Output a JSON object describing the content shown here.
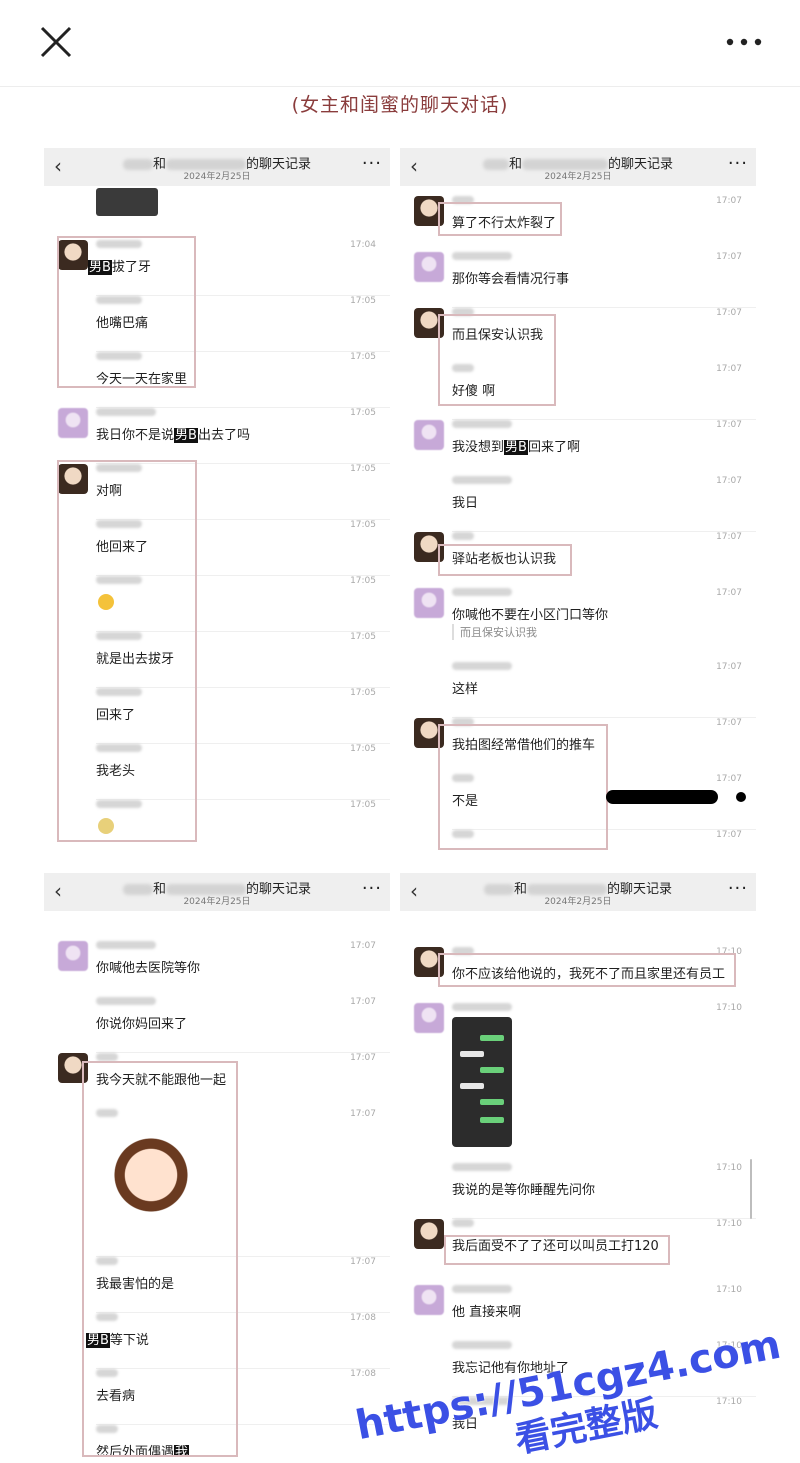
{
  "header": {
    "caption": "(女主和闺蜜的聊天对话)"
  },
  "panels": [
    {
      "title_and": "和",
      "title_suffix": "的聊天记录",
      "date": "2024年2月25日",
      "more": "···",
      "messages": [
        {
          "time": "17:04",
          "redact": "男B",
          "text": "拔了牙"
        },
        {
          "time": "17:05",
          "text": "他嘴巴痛"
        },
        {
          "time": "17:05",
          "text": "今天一天在家里"
        },
        {
          "time": "17:05",
          "prefix": "我日你不是说",
          "redact": "男B",
          "text": "出去了吗"
        },
        {
          "time": "17:05",
          "text": "对啊"
        },
        {
          "time": "17:05",
          "text": "他回来了"
        },
        {
          "time": "17:05",
          "text": ""
        },
        {
          "time": "17:05",
          "text": "就是出去拔牙"
        },
        {
          "time": "17:05",
          "text": "回来了"
        },
        {
          "time": "17:05",
          "text": "我老头"
        },
        {
          "time": "17:05",
          "text": ""
        }
      ]
    },
    {
      "title_and": "和",
      "title_suffix": "的聊天记录",
      "date": "2024年2月25日",
      "more": "···",
      "messages": [
        {
          "time": "17:07",
          "text": "算了不行太炸裂了"
        },
        {
          "time": "17:07",
          "text": "那你等会看情况行事"
        },
        {
          "time": "17:07",
          "text": "而且保安认识我"
        },
        {
          "time": "17:07",
          "text": "好傻 啊"
        },
        {
          "time": "17:07",
          "prefix": "我没想到",
          "redact": "男B",
          "text": "回来了啊"
        },
        {
          "time": "17:07",
          "text": "我日"
        },
        {
          "time": "17:07",
          "text": "驿站老板也认识我"
        },
        {
          "time": "17:07",
          "text": "你喊他不要在小区门口等你",
          "quote": "而且保安认识我"
        },
        {
          "time": "17:07",
          "text": "这样"
        },
        {
          "time": "17:07",
          "text": "我拍图经常借他们的推车"
        },
        {
          "time": "17:07",
          "text": "不是"
        },
        {
          "time": "17:07",
          "text": ""
        }
      ]
    },
    {
      "title_and": "和",
      "title_suffix": "的聊天记录",
      "date": "2024年2月25日",
      "more": "···",
      "messages": [
        {
          "time": "17:07",
          "text": "你喊他去医院等你"
        },
        {
          "time": "17:07",
          "text": "你说你妈回来了"
        },
        {
          "time": "17:07",
          "text": "我今天就不能跟他一起"
        },
        {
          "time": "17:07",
          "text": ""
        },
        {
          "time": "17:07",
          "text": "我最害怕的是"
        },
        {
          "time": "17:08",
          "redact": "男B",
          "text": "等下说"
        },
        {
          "time": "17:08",
          "text": "去看病"
        },
        {
          "time": "",
          "text": "然后外面偶遇",
          "redact": "我"
        }
      ]
    },
    {
      "title_and": "和",
      "title_suffix": "的聊天记录",
      "date": "2024年2月25日",
      "more": "···",
      "messages": [
        {
          "time": "17:10",
          "text": "你不应该给他说的，我死不了而且家里还有员工"
        },
        {
          "time": "17:10",
          "text": ""
        },
        {
          "time": "17:10",
          "text": "我说的是等你睡醒先问你"
        },
        {
          "time": "17:10",
          "text": "我后面受不了了还可以叫员工打120"
        },
        {
          "time": "17:10",
          "text": "他 直接来啊"
        },
        {
          "time": "17:10",
          "text": "我忘记他有你地址了"
        },
        {
          "time": "17:10",
          "text": "我日"
        }
      ]
    }
  ],
  "watermark": {
    "line1": "https://51cgz4.com",
    "line2": "看完整版"
  },
  "colors": {
    "caption": "#8a3c3c",
    "highlight_box": "#d9b9bc",
    "watermark": "#3b50e5"
  },
  "icons": {
    "close": "close-icon",
    "more": "more-dots-icon",
    "back": "chevron-left-icon"
  }
}
